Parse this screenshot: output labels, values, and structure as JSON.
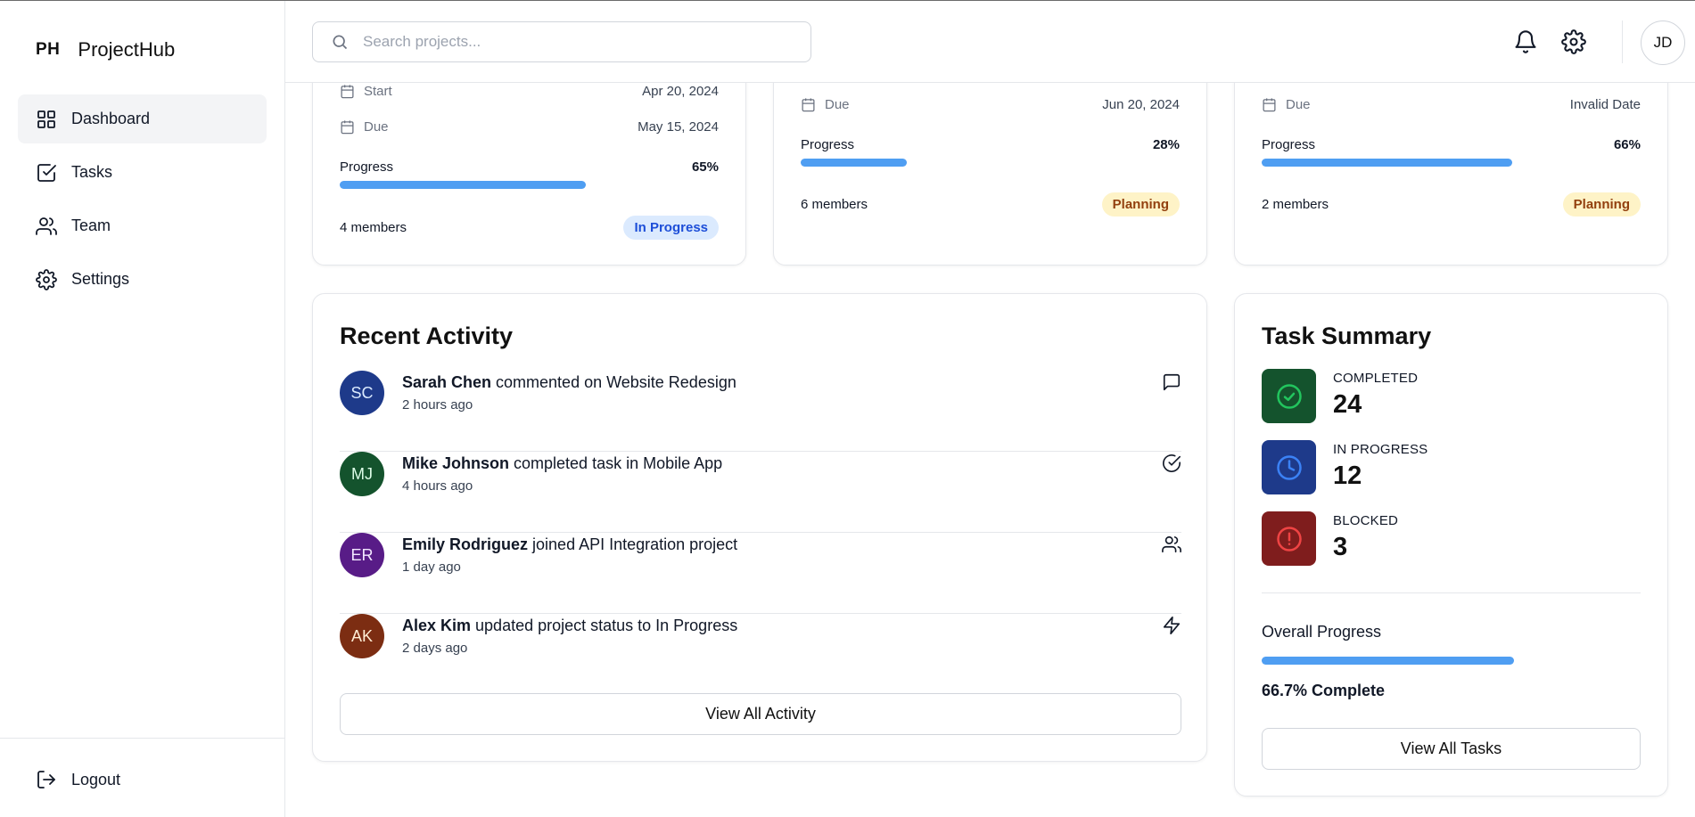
{
  "brand": {
    "logo": "PH",
    "name": "ProjectHub"
  },
  "sidebar": {
    "items": [
      {
        "label": "Dashboard",
        "icon": "grid-icon",
        "active": true
      },
      {
        "label": "Tasks",
        "icon": "checkbox-icon"
      },
      {
        "label": "Team",
        "icon": "users-icon"
      },
      {
        "label": "Settings",
        "icon": "gear-icon"
      }
    ],
    "logout_label": "Logout"
  },
  "header": {
    "search_placeholder": "Search projects...",
    "user_initials": "JD"
  },
  "projects": [
    {
      "start_label": "Start",
      "start": "Apr 20, 2024",
      "due_label": "Due",
      "due": "May 15, 2024",
      "progress_label": "Progress",
      "progress": "65%",
      "progress_value": 0.65,
      "members": "4 members",
      "status": "In Progress",
      "status_bg": "#dbeafe",
      "status_color": "#1d4ed8"
    },
    {
      "due_label": "Due",
      "due": "Jun 20, 2024",
      "progress_label": "Progress",
      "progress": "28%",
      "progress_value": 0.28,
      "members": "6 members",
      "status": "Planning",
      "status_bg": "#fef3c7",
      "status_color": "#92400e"
    },
    {
      "due_label": "Due",
      "due": "Invalid Date",
      "progress_label": "Progress",
      "progress": "66%",
      "progress_value": 0.66,
      "members": "2 members",
      "status": "Planning",
      "status_bg": "#fef3c7",
      "status_color": "#92400e"
    }
  ],
  "activity": {
    "title": "Recent Activity",
    "items": [
      {
        "initials": "SC",
        "name": "Sarah Chen",
        "action": " commented on Website Redesign",
        "time": "2 hours ago",
        "avatar_bg": "#1e3a8a",
        "avatar_fg": "#dbeafe",
        "icon": "comment-icon"
      },
      {
        "initials": "MJ",
        "name": "Mike Johnson",
        "action": " completed task in Mobile App",
        "time": "4 hours ago",
        "avatar_bg": "#14532d",
        "avatar_fg": "#dcfce7",
        "icon": "check-circle-icon"
      },
      {
        "initials": "ER",
        "name": "Emily Rodriguez",
        "action": " joined API Integration project",
        "time": "1 day ago",
        "avatar_bg": "#581c87",
        "avatar_fg": "#f3e8ff",
        "icon": "users-icon"
      },
      {
        "initials": "AK",
        "name": "Alex Kim",
        "action": " updated project status to In Progress",
        "time": "2 days ago",
        "avatar_bg": "#7c2d12",
        "avatar_fg": "#ffedd5",
        "icon": "lightning-icon"
      }
    ],
    "view_all": "View All Activity"
  },
  "summary": {
    "title": "Task Summary",
    "items": [
      {
        "label": "COMPLETED",
        "count": "24",
        "tile_bg": "#14532d",
        "icon_color": "#22c55e",
        "icon": "check-circle-icon"
      },
      {
        "label": "IN PROGRESS",
        "count": "12",
        "tile_bg": "#1e3a8a",
        "icon_color": "#3b82f6",
        "icon": "clock-icon"
      },
      {
        "label": "BLOCKED",
        "count": "3",
        "tile_bg": "#7f1d1d",
        "icon_color": "#ef4444",
        "icon": "alert-circle-icon"
      }
    ],
    "overall_label": "Overall Progress",
    "overall_value": 0.667,
    "overall_text": "66.7% Complete",
    "view_all": "View All Tasks"
  },
  "colors": {
    "accent": "#4f9ef2",
    "border": "#e5e7eb"
  }
}
